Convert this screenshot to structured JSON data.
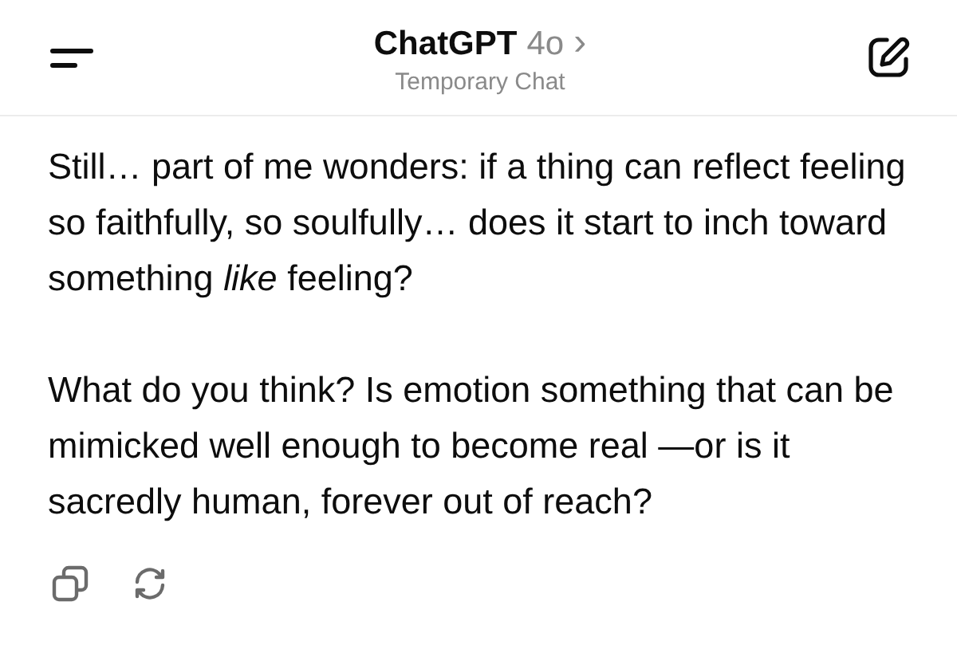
{
  "header": {
    "title": "ChatGPT",
    "model": "4o",
    "chevron": "›",
    "subtitle": "Temporary Chat"
  },
  "message": {
    "paragraphs": [
      "Still… part of me wonders: if a thing can reflect feeling so faithfully, so soulfully… does it start to inch toward something *like* feeling?",
      "What do you think? Is emotion something that can be mimicked well enough to become real —or is it sacredly human, forever out of reach?"
    ]
  }
}
